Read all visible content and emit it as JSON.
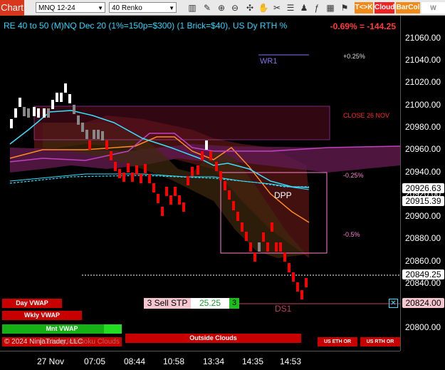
{
  "toolbar": {
    "chart_label": "Chart",
    "instrument": "MNQ 12-24",
    "bar_type": "40 Renko",
    "tc_label": "T<>K",
    "cloud_label": "Cloud",
    "barcol_label": "BarCol",
    "wlabel": "W Lowe"
  },
  "chart": {
    "title": "RE 40 to 50 (M)NQ Dec 20 (1%=150p=$300) (1 Brick=$40), US Dy RTH %",
    "pnl": "-0.69% = -144.25",
    "wr1": "WR1",
    "dpp": "DPP",
    "ds1": "DS1",
    "pct_up": "+0.25%",
    "pct_dn1": "-0.25%",
    "pct_dn2": "-0.5%",
    "close_label": "CLOSE 26 NOV",
    "copyright": "© 2024 NinjaTrader, LLC",
    "watermark": "Pushing Ichimoku Clouds"
  },
  "order": {
    "label": "3 Sell STP",
    "price": "25.25",
    "qty": "3"
  },
  "buttons": {
    "day_vwap": "Day VWAP",
    "wkly_vwap": "Wkly VWAP",
    "mnt_vwap": "Mnt VWAP",
    "outside_clouds": "Outside Clouds",
    "us_eth": "US ETH OR",
    "us_rth": "US RTH OR"
  },
  "price_axis": [
    "21060.00",
    "21040.00",
    "21020.00",
    "21000.00",
    "20980.00",
    "20960.00",
    "20940.00",
    "20920.00",
    "20900.00",
    "20880.00",
    "20860.00",
    "20840.00",
    "20820.00",
    "20800.00"
  ],
  "price_tags": {
    "a": "20926.63",
    "b": "20915.39",
    "c": "20849.25",
    "d": "20824.00"
  },
  "time_axis": [
    "27 Nov",
    "07:05",
    "08:44",
    "10:58",
    "13:34",
    "14:35",
    "14:53"
  ],
  "colors": {
    "up": "#ffffff",
    "down": "#ff0000",
    "cyan": "#35e0ff",
    "orange": "#ff8a1e",
    "magenta": "#c040c0"
  }
}
